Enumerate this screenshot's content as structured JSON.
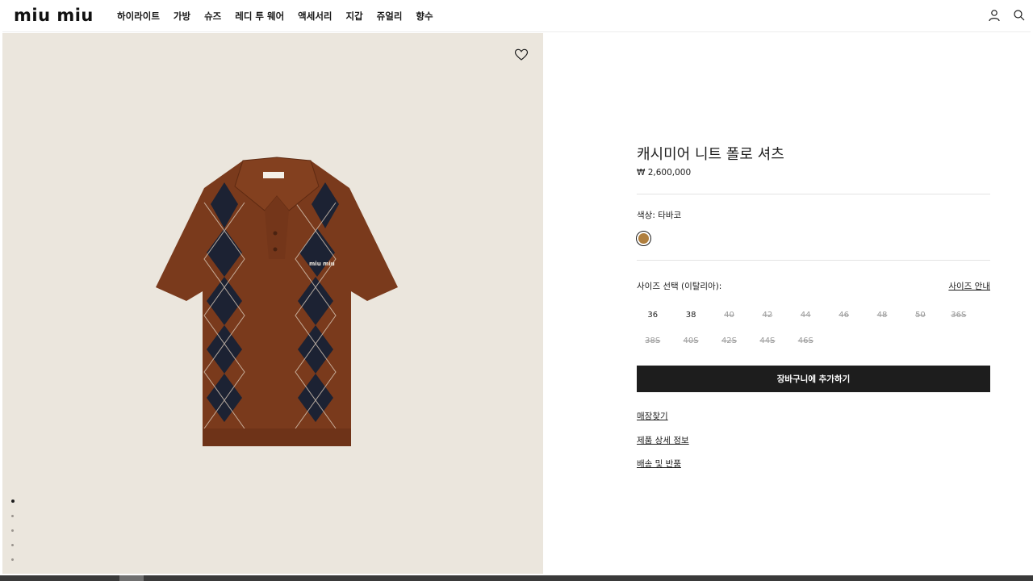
{
  "header": {
    "logo": "miu miu",
    "nav": [
      "하이라이트",
      "가방",
      "슈즈",
      "레디 투 웨어",
      "액세서리",
      "지갑",
      "쥬얼리",
      "향수"
    ],
    "icons": [
      "user-icon",
      "search-icon"
    ]
  },
  "product": {
    "title": "캐시미어 니트 폴로 셔츠",
    "price": "₩ 2,600,000",
    "color_label": "색상:  타바코",
    "color_swatch": "#b07f3e",
    "size_label": "사이즈 선택 (이탈리아):",
    "size_guide": "사이즈 안내",
    "sizes": [
      {
        "label": "36",
        "available": true
      },
      {
        "label": "38",
        "available": true
      },
      {
        "label": "40",
        "available": false
      },
      {
        "label": "42",
        "available": false
      },
      {
        "label": "44",
        "available": false
      },
      {
        "label": "46",
        "available": false
      },
      {
        "label": "48",
        "available": false
      },
      {
        "label": "50",
        "available": false
      },
      {
        "label": "36S",
        "available": false
      },
      {
        "label": "38S",
        "available": false
      },
      {
        "label": "40S",
        "available": false
      },
      {
        "label": "42S",
        "available": false
      },
      {
        "label": "44S",
        "available": false
      },
      {
        "label": "46S",
        "available": false
      }
    ],
    "add_to_cart": "장바구니에 추가하기",
    "links": [
      "매장찾기",
      "제품 상세 정보",
      "배송 및 반품"
    ]
  },
  "gallery": {
    "image_icon": "polo-shirt-image",
    "dot_count": 5,
    "active_dot": 0,
    "shirt_colors": {
      "body": "#7a3a1c",
      "argyle": "#1c2233",
      "line": "#d9c9b8"
    },
    "background": "#ebe6dd"
  }
}
